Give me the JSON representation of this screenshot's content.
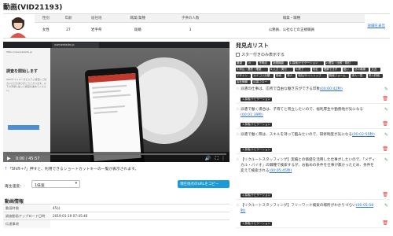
{
  "page_title": "動画(VID21193)",
  "profile": {
    "headers": [
      "性別",
      "年齢",
      "居住地",
      "職業/業種",
      "子供の人数",
      "職業・職種"
    ],
    "values": [
      "女性",
      "27",
      "岩手県",
      "既婚",
      "3",
      "公務員、公社などの正規職員"
    ],
    "detail_link": "詳細を表示"
  },
  "video": {
    "tab_label": "userwebsite.jp",
    "left_logo": "https://userwebsite.jp",
    "left_heading": "調査を開始します",
    "left_body": "Webサイトユーザビリティ調査にご協力いただきありがとうございます。以下の手順に従って調査を進めてください。",
    "time": "0:00 / 45:57",
    "progress": 0.0
  },
  "hint": {
    "prefix": "?",
    "text": "「Shift＋?」押すと、利用できるショートカットキーの一覧が表示されます。"
  },
  "speed": {
    "label": "再生速度：",
    "value": "1倍速"
  },
  "copy_button": "現在地点のURLをコピー",
  "info": {
    "title": "動画情報",
    "rows": [
      {
        "k": "動画時間",
        "v": "45分"
      },
      {
        "k": "調査動画アップロード日時",
        "v": "2019-01-19 07:45:46"
      },
      {
        "k": "伝達事項",
        "v": ""
      }
    ]
  },
  "right": {
    "title": "発見点リスト",
    "star_filter": "スター付きのみ表示する",
    "tags": [
      "要望",
      "UI",
      "不明点",
      "新規機能",
      "1.探索/ナビゲーション",
      "2.閲覧・比較・検討",
      "3.申込・選択・確認",
      "4.入力・実行",
      "5.終了",
      "未定",
      "理解できず",
      "迷い",
      "次の導線",
      "文言",
      "デザイン",
      "カテゴリ分類",
      "検索",
      "求人",
      "他社/サイトトップ",
      "検索フォーム",
      "求人一覧",
      "求人詳細",
      "会社情報",
      "応募フロー"
    ],
    "comments": [
      {
        "text": "派遣の仕事は、応所で自由な働き方ができる印象",
        "time": "(00:00:42秒)",
        "badge": "1.探索/ナビゲーション"
      },
      {
        "text": "派遣で働く場合は、子育てと両立したいので、福利厚生や勤務地が気になる",
        "time": "(00:01:39秒)",
        "badge": "1.探索/ナビゲーション"
      },
      {
        "text": "派遣で働く際は、スキルを持って臨みたいので、研修制度が気になる",
        "time": "(00:02:55秒)",
        "badge": "1.探索/ナビゲーション"
      },
      {
        "text": "【リクルートスタッフィング】実績との価値を活用した仕事がしたいので、「メディカル・バイオ」の職種で検索するが、お勧めの条件を仕事が無かったため、条件を変えて検索される",
        "time": "(00:05:45秒)",
        "badge": "1.探索/ナビゲーション"
      },
      {
        "text": "【リクルートスタッフィング】フリーワード検索の場所がわかりづらい",
        "time": "(00:05:58秒)",
        "badge": "1.探索/ナビゲーション"
      }
    ]
  }
}
